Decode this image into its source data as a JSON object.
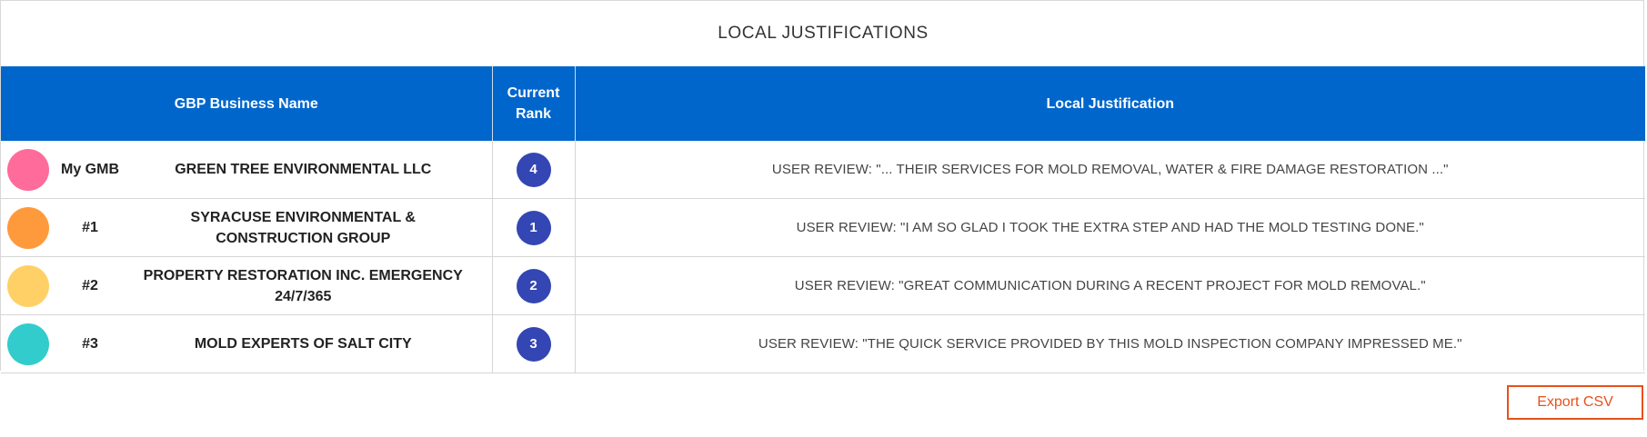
{
  "panel": {
    "title": "LOCAL JUSTIFICATIONS"
  },
  "table": {
    "headers": {
      "business": "GBP Business Name",
      "rank": "Current Rank",
      "justification": "Local Justification"
    },
    "rows": [
      {
        "label": "My GMB",
        "business": "GREEN TREE ENVIRONMENTAL LLC",
        "rank": "4",
        "color": "#ff6b9a",
        "justification": "USER REVIEW: \"... THEIR SERVICES FOR MOLD REMOVAL, WATER & FIRE DAMAGE RESTORATION ...\""
      },
      {
        "label": "#1",
        "business": "SYRACUSE ENVIRONMENTAL & CONSTRUCTION GROUP",
        "rank": "1",
        "color": "#ff9a3c",
        "justification": "USER REVIEW: \"I AM SO GLAD I TOOK THE EXTRA STEP AND HAD THE MOLD TESTING DONE.\""
      },
      {
        "label": "#2",
        "business": "PROPERTY RESTORATION INC. EMERGENCY 24/7/365",
        "rank": "2",
        "color": "#ffd066",
        "justification": "USER REVIEW: \"GREAT COMMUNICATION DURING A RECENT PROJECT FOR MOLD REMOVAL.\""
      },
      {
        "label": "#3",
        "business": "MOLD EXPERTS OF SALT CITY",
        "rank": "3",
        "color": "#33cccc",
        "justification": "USER REVIEW: \"THE QUICK SERVICE PROVIDED BY THIS MOLD INSPECTION COMPANY IMPRESSED ME.\""
      }
    ]
  },
  "actions": {
    "export_label": "Export CSV"
  },
  "colors": {
    "header_bg": "#0066cc",
    "rank_badge": "#3346b3",
    "export_accent": "#e8501a"
  }
}
